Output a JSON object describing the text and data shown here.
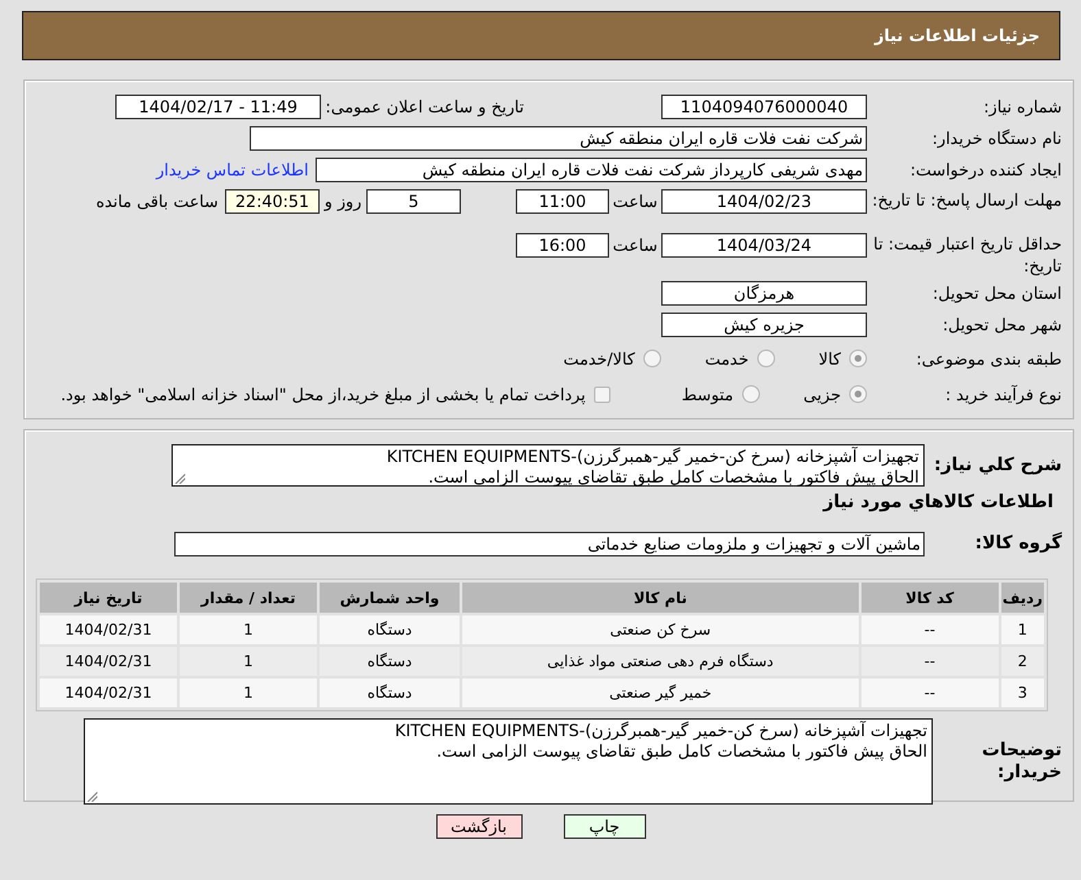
{
  "header": {
    "title": "جزئیات اطلاعات نیاز"
  },
  "need_number": {
    "label": "شماره نیاز:",
    "value": "1104094076000040"
  },
  "announce": {
    "label": "تاریخ و ساعت اعلان عمومی:",
    "value": "1404/02/17 - 11:49"
  },
  "buyer_org": {
    "label": "نام دستگاه خریدار:",
    "value": "شرکت نفت فلات قاره ایران منطقه کیش"
  },
  "requester": {
    "label": "ایجاد کننده درخواست:",
    "value": "مهدی شریفی کارپرداز شرکت نفت فلات قاره ایران منطقه کیش",
    "link": "اطلاعات تماس خریدار"
  },
  "reply_deadline": {
    "label": "مهلت ارسال پاسخ: تا تاریخ:",
    "date": "1404/02/23",
    "time_label": "ساعت",
    "time": "11:00",
    "days": "5",
    "days_label": "روز و",
    "remaining": "22:40:51",
    "remaining_label": "ساعت باقی مانده"
  },
  "price_validity": {
    "label": "حداقل تاریخ اعتبار قیمت: تا تاریخ:",
    "date": "1404/03/24",
    "time_label": "ساعت",
    "time": "16:00"
  },
  "province": {
    "label": "استان محل تحویل:",
    "value": "هرمزگان"
  },
  "city": {
    "label": "شهر محل تحویل:",
    "value": "جزیره کیش"
  },
  "category": {
    "label": "طبقه بندی موضوعی:",
    "options": [
      {
        "label": "کالا",
        "selected": true
      },
      {
        "label": "خدمت",
        "selected": false
      },
      {
        "label": "کالا/خدمت",
        "selected": false
      }
    ]
  },
  "process": {
    "label": "نوع فرآیند خرید :",
    "options": [
      {
        "label": "جزیی",
        "selected": true
      },
      {
        "label": "متوسط",
        "selected": false
      }
    ],
    "payment": {
      "checked": false,
      "text": "پرداخت تمام یا بخشی از مبلغ خرید،از محل \"اسناد خزانه اسلامی\" خواهد بود."
    }
  },
  "summary": {
    "label": "شرح کلي نياز:",
    "lines": [
      "تجهیزات آشپزخانه (سرخ کن-خمیر گیر-همبرگرزن)-KITCHEN EQUIPMENTS",
      "الحاق پیش فاکتور با مشخصات کامل طبق تقاضای پیوست الزامی است."
    ]
  },
  "goods_heading": "اطلاعات کالاهاي مورد نياز",
  "goods_group": {
    "label": "گروه کالا:",
    "value": "ماشین آلات و تجهیزات و ملزومات صنایع خدماتی"
  },
  "table": {
    "columns": [
      "ردیف",
      "کد کالا",
      "نام کالا",
      "واحد شمارش",
      "تعداد / مقدار",
      "تاریخ نیاز"
    ],
    "rows": [
      [
        "1",
        "--",
        "سرخ کن صنعتی",
        "دستگاه",
        "1",
        "1404/02/31"
      ],
      [
        "2",
        "--",
        "دستگاه فرم دهی صنعتی مواد غذایی",
        "دستگاه",
        "1",
        "1404/02/31"
      ],
      [
        "3",
        "--",
        "خمیر گیر صنعتی",
        "دستگاه",
        "1",
        "1404/02/31"
      ]
    ]
  },
  "buyer_notes": {
    "label": "توضیحات خریدار:",
    "lines": [
      "تجهیزات آشپزخانه (سرخ کن-خمیر گیر-همبرگرزن)-KITCHEN EQUIPMENTS",
      "الحاق پیش فاکتور با مشخصات کامل طبق تقاضای پیوست الزامی است."
    ]
  },
  "buttons": [
    {
      "label": "چاپ",
      "kind": "print"
    },
    {
      "label": "بازگشت",
      "kind": "back"
    }
  ]
}
